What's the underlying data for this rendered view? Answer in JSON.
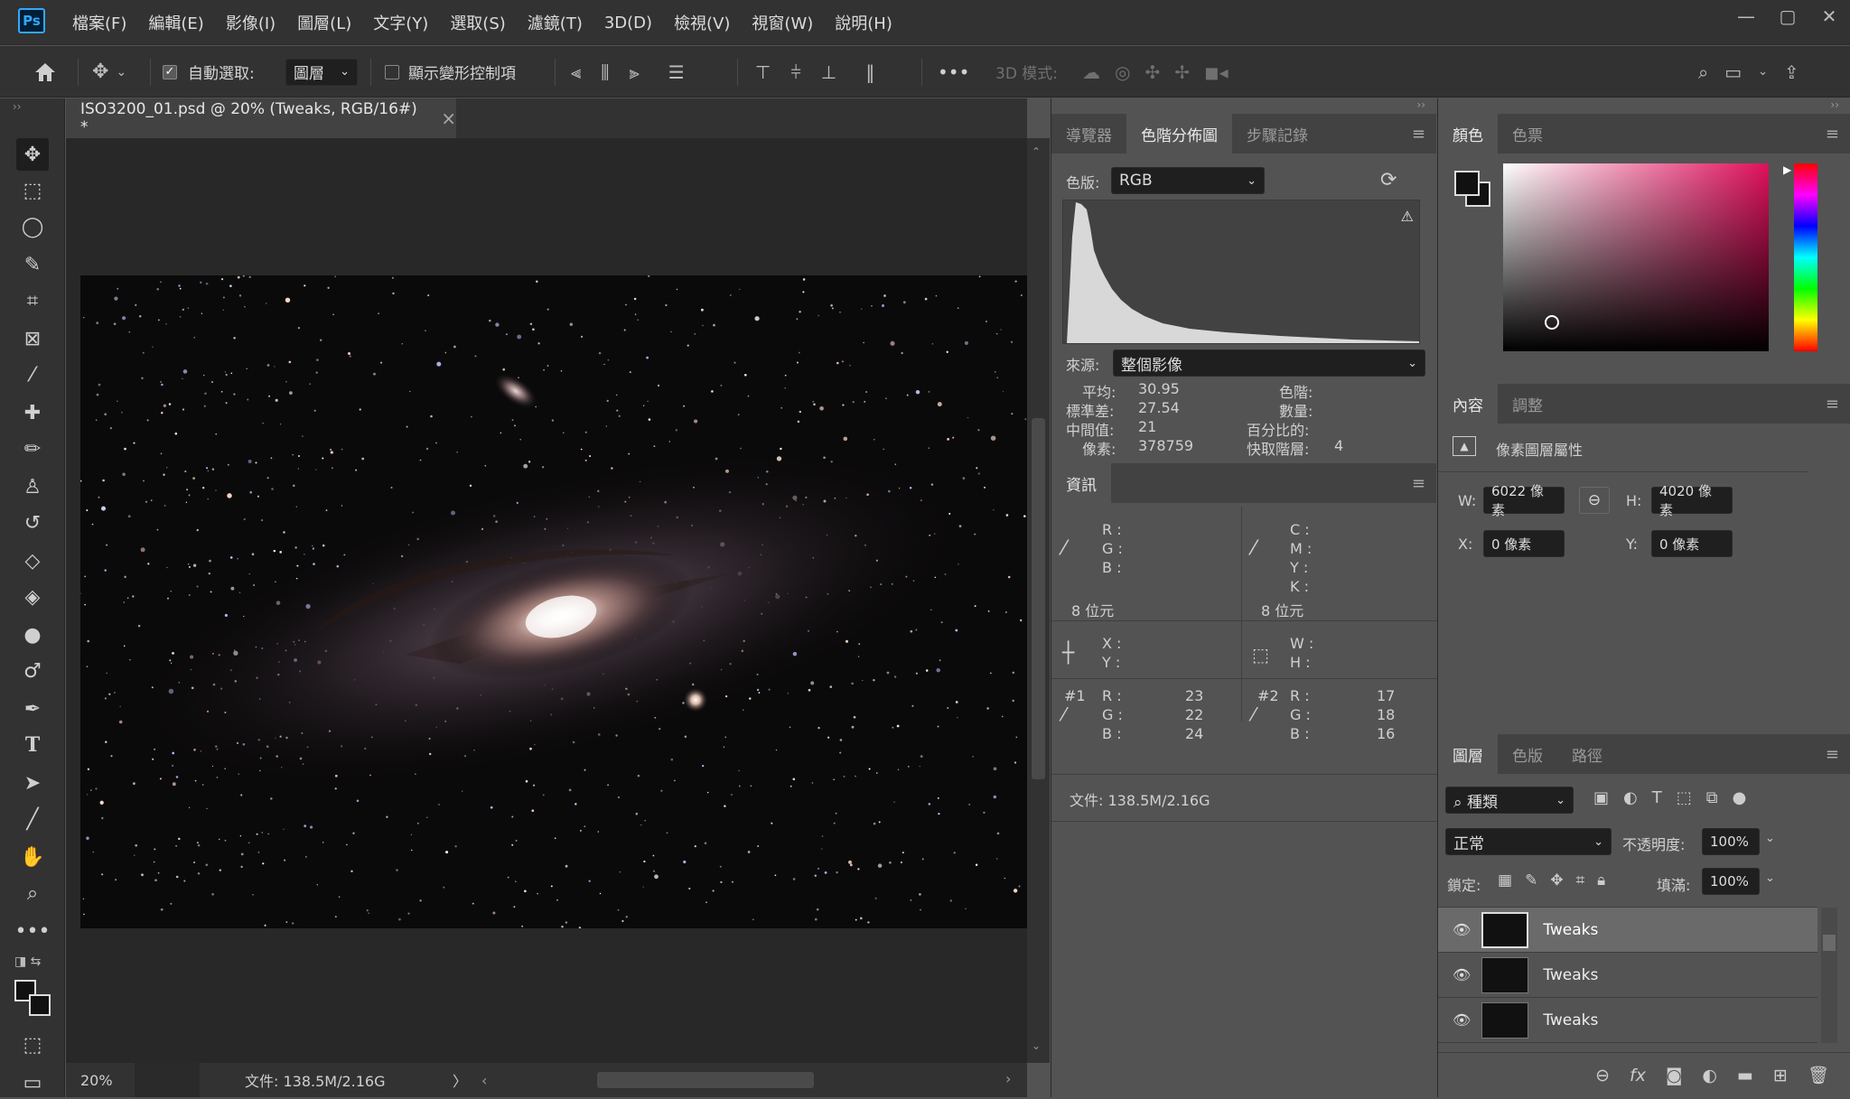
{
  "app": {
    "logo": "Ps"
  },
  "menu": [
    "檔案(F)",
    "編輯(E)",
    "影像(I)",
    "圖層(L)",
    "文字(Y)",
    "選取(S)",
    "濾鏡(T)",
    "3D(D)",
    "檢視(V)",
    "視窗(W)",
    "說明(H)"
  ],
  "options": {
    "auto_select_label": "自動選取:",
    "auto_select_value": "圖層",
    "show_transform_label": "顯示變形控制項",
    "mode_3d_label": "3D 模式:",
    "more": "•••"
  },
  "document": {
    "tab_title": "ISO3200_01.psd @ 20% (Tweaks, RGB/16#) *",
    "close": "×"
  },
  "status": {
    "zoom": "20%",
    "doc_size": "文件: 138.5M/2.16G",
    "arrow": "〉",
    "left_arrow": "‹",
    "right_arrow": "›"
  },
  "mid_tabs": [
    "導覽器",
    "色階分佈圖",
    "步驟記錄"
  ],
  "histogram": {
    "channel_label": "色版:",
    "channel_value": "RGB",
    "source_label": "來源:",
    "source_value": "整個影像",
    "stats": {
      "mean_label": "平均:",
      "mean": "30.95",
      "std_label": "標準差:",
      "std": "27.54",
      "median_label": "中間值:",
      "median": "21",
      "pixels_label": "像素:",
      "pixels": "378759",
      "level_label": "色階:",
      "count_label": "數量:",
      "percentile_label": "百分比的:",
      "cache_label": "快取階層:",
      "cache": "4"
    }
  },
  "info": {
    "tab": "資訊",
    "r": "R :",
    "g": "G :",
    "b": "B :",
    "c": "C :",
    "m": "M :",
    "y": "Y :",
    "k": "K :",
    "bits1": "8 位元",
    "bits2": "8 位元",
    "x": "X :",
    "yy": "Y :",
    "w": "W :",
    "h": "H :",
    "s1": "#1",
    "s1_r": "23",
    "s1_g": "22",
    "s1_b": "24",
    "s2": "#2",
    "s2_r": "17",
    "s2_g": "18",
    "s2_b": "16",
    "doc": "文件: 138.5M/2.16G"
  },
  "color_tabs": [
    "顏色",
    "色票"
  ],
  "props_tabs": [
    "內容",
    "調整"
  ],
  "props": {
    "title": "像素圖層屬性",
    "w_label": "W:",
    "w": "6022 像素",
    "h_label": "H:",
    "h": "4020 像素",
    "x_label": "X:",
    "x": "0 像素",
    "y_label": "Y:",
    "y": "0 像素"
  },
  "layer_tabs": [
    "圖層",
    "色版",
    "路徑"
  ],
  "layers_panel": {
    "filter": "種類",
    "blend": "正常",
    "opacity_label": "不透明度:",
    "opacity": "100%",
    "lock_label": "鎖定:",
    "fill_label": "填滿:",
    "fill": "100%",
    "items": [
      {
        "name": "Tweaks"
      },
      {
        "name": "Tweaks"
      },
      {
        "name": "Tweaks"
      }
    ]
  },
  "colors": {
    "accent": "#31a8ff",
    "panel": "#535353",
    "chrome": "#323232"
  }
}
